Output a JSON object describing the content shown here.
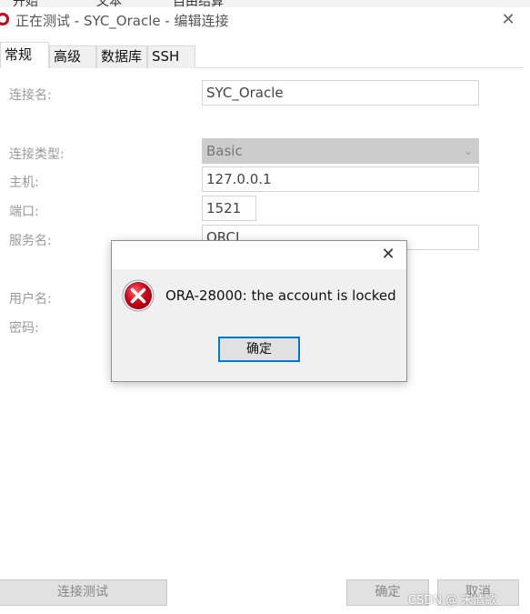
{
  "toolbar_strip": {
    "items": [
      "开始  ",
      "文本",
      "自由结算"
    ]
  },
  "window": {
    "title": "正在测试 - SYC_Oracle - 编辑连接",
    "close_glyph": "✕"
  },
  "tabs": [
    {
      "label": "常规",
      "active": true
    },
    {
      "label": "高级",
      "active": false
    },
    {
      "label": "数据库",
      "active": false
    },
    {
      "label": "SSH",
      "active": false
    }
  ],
  "form": {
    "connection_name_label": "连接名:",
    "connection_name_value": "SYC_Oracle",
    "connection_type_label": "连接类型:",
    "connection_type_value": "Basic",
    "host_label": "主机:",
    "host_value": "127.0.0.1",
    "port_label": "端口:",
    "port_value": "1521",
    "service_label": "服务名:",
    "service_value": "ORCL",
    "username_label": "用户名:",
    "password_label": "密码:"
  },
  "buttons": {
    "test_connection": "连接测试",
    "ok": "确定",
    "cancel": "取消"
  },
  "dialog": {
    "message": "ORA-28000: the account is locked",
    "ok_label": "确定",
    "close_glyph": "✕",
    "icon": "error-icon"
  },
  "watermark": "CSDN @ 宋清歌",
  "colors": {
    "error_red": "#d0021b",
    "focus_blue": "#0078d7"
  }
}
